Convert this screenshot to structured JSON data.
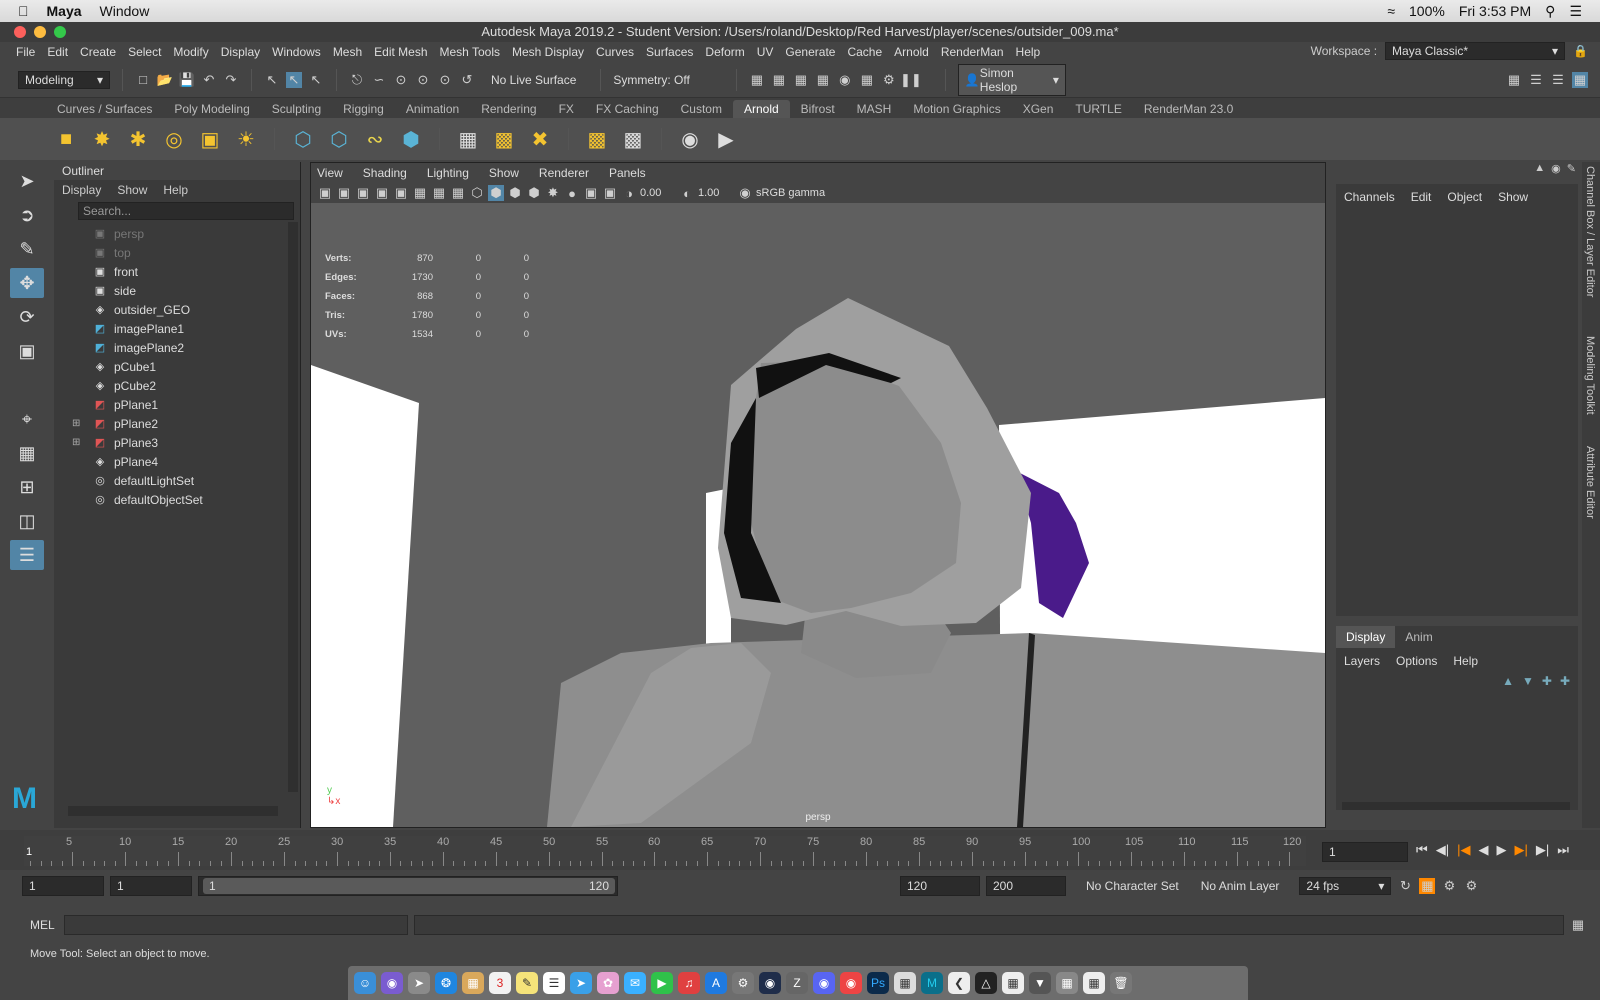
{
  "mac": {
    "app": "Maya",
    "window": "Window",
    "battery": "100%",
    "clock": "Fri 3:53 PM"
  },
  "title": "Autodesk Maya 2019.2 - Student Version: /Users/roland/Desktop/Red Harvest/player/scenes/outsider_009.ma*",
  "menus": [
    "File",
    "Edit",
    "Create",
    "Select",
    "Modify",
    "Display",
    "Windows",
    "Mesh",
    "Edit Mesh",
    "Mesh Tools",
    "Mesh Display",
    "Curves",
    "Surfaces",
    "Deform",
    "UV",
    "Generate",
    "Cache",
    "Arnold",
    "RenderMan",
    "Help"
  ],
  "workspace": {
    "label": "Workspace :",
    "value": "Maya Classic*"
  },
  "status": {
    "mode": "Modeling",
    "live": "No Live Surface",
    "symmetry": "Symmetry: Off",
    "user": "Simon Heslop"
  },
  "shelf_tabs": [
    "Curves / Surfaces",
    "Poly Modeling",
    "Sculpting",
    "Rigging",
    "Animation",
    "Rendering",
    "FX",
    "FX Caching",
    "Custom",
    "Arnold",
    "Bifrost",
    "MASH",
    "Motion Graphics",
    "XGen",
    "TURTLE",
    "RenderMan 23.0"
  ],
  "active_shelf": "Arnold",
  "outliner": {
    "title": "Outliner",
    "menu": [
      "Display",
      "Show",
      "Help"
    ],
    "search": "Search...",
    "items": [
      {
        "name": "persp",
        "icon": "camera-icon",
        "dim": true,
        "expand": false
      },
      {
        "name": "top",
        "icon": "camera-icon",
        "dim": true,
        "expand": false
      },
      {
        "name": "front",
        "icon": "camera-icon",
        "dim": false,
        "expand": false
      },
      {
        "name": "side",
        "icon": "camera-icon",
        "dim": false,
        "expand": false
      },
      {
        "name": "outsider_GEO",
        "icon": "group-icon",
        "dim": false,
        "expand": false
      },
      {
        "name": "imagePlane1",
        "icon": "image-plane-icon",
        "dim": false,
        "expand": false
      },
      {
        "name": "imagePlane2",
        "icon": "image-plane-icon",
        "dim": false,
        "expand": false
      },
      {
        "name": "pCube1",
        "icon": "group-icon",
        "dim": false,
        "expand": false
      },
      {
        "name": "pCube2",
        "icon": "group-icon",
        "dim": false,
        "expand": false
      },
      {
        "name": "pPlane1",
        "icon": "mesh-icon",
        "dim": false,
        "expand": false
      },
      {
        "name": "pPlane2",
        "icon": "mesh-icon",
        "dim": false,
        "expand": true
      },
      {
        "name": "pPlane3",
        "icon": "mesh-icon",
        "dim": false,
        "expand": true
      },
      {
        "name": "pPlane4",
        "icon": "group-icon",
        "dim": false,
        "expand": false
      },
      {
        "name": "defaultLightSet",
        "icon": "set-icon",
        "dim": false,
        "expand": false
      },
      {
        "name": "defaultObjectSet",
        "icon": "set-icon",
        "dim": false,
        "expand": false
      }
    ]
  },
  "viewport": {
    "menu": [
      "View",
      "Shading",
      "Lighting",
      "Show",
      "Renderer",
      "Panels"
    ],
    "exposure": "0.00",
    "gamma": "1.00",
    "colorspace": "sRGB gamma",
    "camera": "persp",
    "hud": [
      [
        "Verts:",
        "870",
        "0",
        "0"
      ],
      [
        "Edges:",
        "1730",
        "0",
        "0"
      ],
      [
        "Faces:",
        "868",
        "0",
        "0"
      ],
      [
        "Tris:",
        "1780",
        "0",
        "0"
      ],
      [
        "UVs:",
        "1534",
        "0",
        "0"
      ]
    ]
  },
  "channelbox": {
    "menu": [
      "Channels",
      "Edit",
      "Object",
      "Show"
    ]
  },
  "layers": {
    "tabs": [
      "Display",
      "Anim"
    ],
    "menu": [
      "Layers",
      "Options",
      "Help"
    ]
  },
  "side_tabs": [
    "Channel Box / Layer Editor",
    "Modeling Toolkit",
    "Attribute Editor"
  ],
  "time": {
    "ticks": [
      5,
      10,
      15,
      20,
      25,
      30,
      35,
      40,
      45,
      50,
      55,
      60,
      65,
      70,
      75,
      80,
      85,
      90,
      95,
      100,
      105,
      110,
      115,
      120
    ],
    "current": "1",
    "start": "1",
    "playstart": "1",
    "rangeStart": "1",
    "rangeEnd": "120",
    "end": "120",
    "animEnd": "200",
    "charset": "No Character Set",
    "animlayer": "No Anim Layer",
    "fps": "24 fps"
  },
  "mel": "MEL",
  "help": "Move Tool: Select an object to move."
}
